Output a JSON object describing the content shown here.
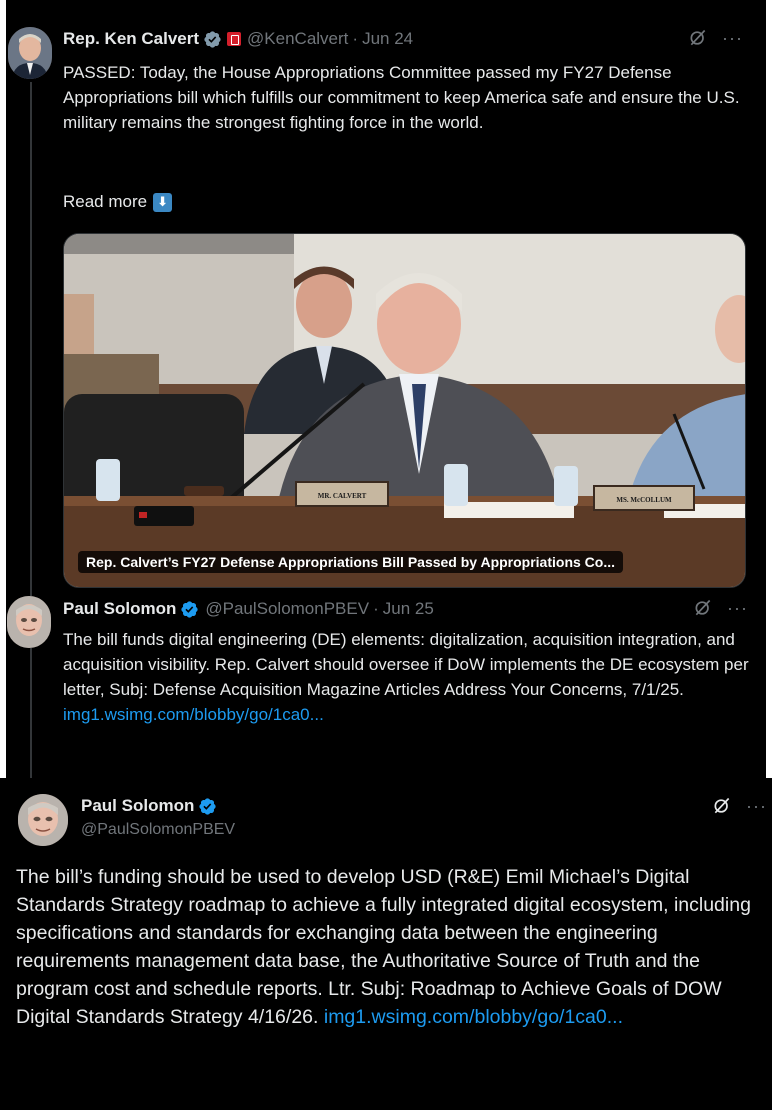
{
  "tweet1": {
    "name": "Rep. Ken Calvert",
    "handle": "@KenCalvert",
    "date": "Jun 24",
    "text": "PASSED: Today, the House Appropriations Committee passed my FY27 Defense Appropriations bill which fulfills our commitment to keep America safe and ensure the U.S. military remains the strongest fighting force in the world.",
    "read_more": "Read more",
    "media_caption": "Rep. Calvert’s FY27 Defense Appropriations Bill Passed by Appropriations Co...",
    "placards": [
      "MR. CALVERT",
      "MS. McCOLLUM"
    ]
  },
  "tweet2": {
    "name": "Paul Solomon",
    "handle": "@PaulSolomonPBEV",
    "date": "Jun 25",
    "text": "The bill funds digital engineering (DE) elements: digitalization, acquisition integration, and acquisition visibility. Rep. Calvert should oversee if DoW implements the DE ecosystem per letter, Subj: Defense Acquisition Magazine Articles Address Your Concerns, 7/1/25.",
    "link": "img1.wsimg.com/blobby/go/1ca0..."
  },
  "tweet3": {
    "name": "Paul Solomon",
    "handle": "@PaulSolomonPBEV",
    "text": "The bill’s funding should be used to develop USD (R&E) Emil Michael’s Digital Standards Strategy roadmap to achieve a fully integrated digital ecosystem, including specifications and standards for exchanging data between the engineering requirements management data base, the Authoritative Source of Truth and the program cost and schedule reports. Ltr. Subj: Roadmap to Achieve Goals of DOW Digital Standards Strategy 4/16/26.",
    "link": "img1.wsimg.com/blobby/go/1ca0..."
  },
  "common": {
    "dot": "·",
    "more": "···"
  },
  "icons": {
    "verified": "verified-badge-icon",
    "grok": "grok-icon",
    "more": "more-icon",
    "down_arrow": "down-arrow-emoji-icon",
    "flag": "government-flag-icon"
  },
  "colors": {
    "background": "#000000",
    "text": "#e7e9ea",
    "secondary": "#71767b",
    "link": "#1d9bf0",
    "verified": "#1d9bf0"
  }
}
